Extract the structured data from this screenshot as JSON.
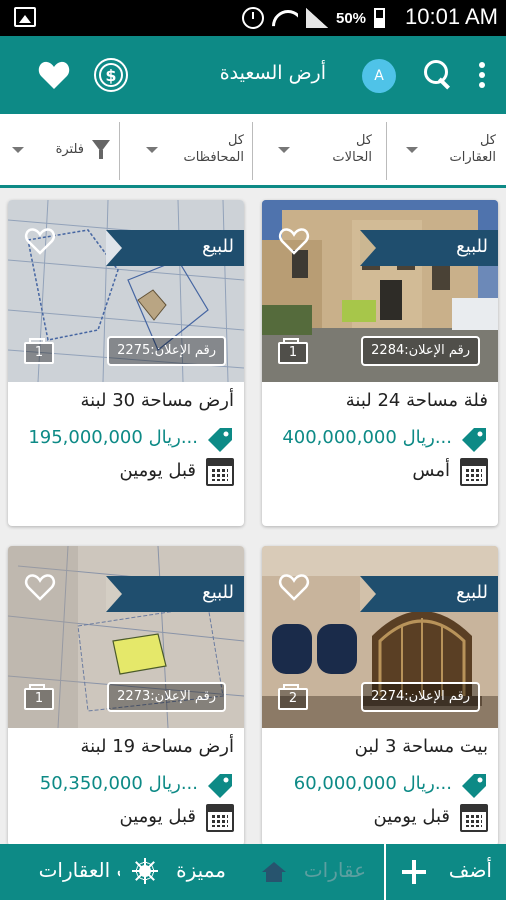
{
  "status_bar": {
    "battery": "50%",
    "time": "10:01 AM"
  },
  "app_bar": {
    "title": "أرض السعيدة",
    "avatar_letter": "A",
    "currency_symbol": "$",
    "accent_color": "#0d8a86"
  },
  "filters": {
    "property_type": "كل\nالعقارات",
    "status": "كل\nالحالات",
    "governorate": "كل\nالمحافظات",
    "filter_label": "فلترة"
  },
  "listings": [
    {
      "badge": "للبيع",
      "ad_id": "رقم الإعلان:2284",
      "image_count": "1",
      "title": "فلة  مساحة 24 لبنة",
      "price": "400,000,000 ريال...",
      "date": "أمس",
      "photo_theme": "villa"
    },
    {
      "badge": "للبيع",
      "ad_id": "رقم الإعلان:2275",
      "image_count": "1",
      "title": "أرض  مساحة 30 لبنة",
      "price": "195,000,000 ريال...",
      "date": "قبل يومين",
      "photo_theme": "land-map"
    },
    {
      "badge": "للبيع",
      "ad_id": "رقم الإعلان:2274",
      "image_count": "2",
      "title": "بيت  مساحة 3 لبن",
      "price": "60,000,000 ريال...",
      "date": "قبل يومين",
      "photo_theme": "house-gate"
    },
    {
      "badge": "للبيع",
      "ad_id": "رقم الإعلان:2273",
      "image_count": "1",
      "title": "أرض  مساحة 19 لبنة",
      "price": "50,350,000 ريال...",
      "date": "قبل يومين",
      "photo_theme": "land-map"
    }
  ],
  "bottom_nav": {
    "add": "أضف",
    "real_estate": "عقارات",
    "featured": "مميزة",
    "requests": "طلبات العقارات"
  }
}
